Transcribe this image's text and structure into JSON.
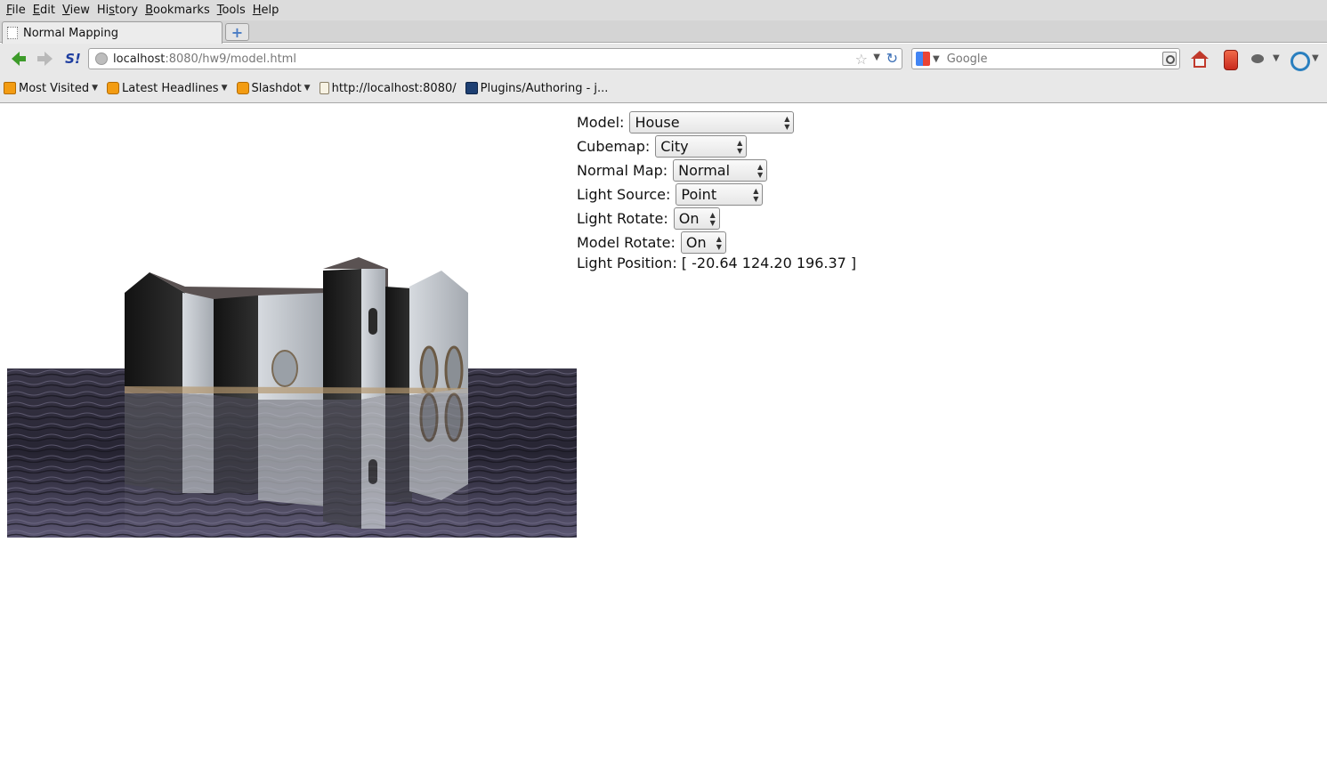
{
  "menubar": {
    "items": [
      {
        "label": "File",
        "accel": "F",
        "rest": "ile"
      },
      {
        "label": "Edit",
        "accel": "E",
        "rest": "dit"
      },
      {
        "label": "View",
        "accel": "V",
        "rest": "iew"
      },
      {
        "label": "History",
        "accel": "",
        "pre": "Hi",
        "mid": "s",
        "post": "tory"
      },
      {
        "label": "Bookmarks",
        "accel": "B",
        "rest": "ookmarks"
      },
      {
        "label": "Tools",
        "accel": "T",
        "rest": "ools"
      },
      {
        "label": "Help",
        "accel": "H",
        "rest": "elp"
      }
    ]
  },
  "tabs": {
    "active_title": "Normal Mapping",
    "new_tab_symbol": "+"
  },
  "navbar": {
    "url_host": "localhost",
    "url_rest": ":8080/hw9/model.html",
    "search_placeholder": "Google",
    "star_symbol": "☆",
    "dropdown_symbol": "▼",
    "reload_symbol": "↻",
    "s_icon_left": "S",
    "s_icon_right": "!"
  },
  "bookmarks": [
    {
      "label": "Most Visited",
      "icon": "rss-folder-icon",
      "has_arrow": true
    },
    {
      "label": "Latest Headlines",
      "icon": "rss-icon",
      "has_arrow": true
    },
    {
      "label": "Slashdot",
      "icon": "rss-icon",
      "has_arrow": true
    },
    {
      "label": "http://localhost:8080/",
      "icon": "page-icon",
      "has_arrow": false
    },
    {
      "label": "Plugins/Authoring - j...",
      "icon": "site-icon",
      "has_arrow": false
    }
  ],
  "controls": {
    "model": {
      "label": "Model:",
      "value": "House"
    },
    "cubemap": {
      "label": "Cubemap:",
      "value": "City"
    },
    "normal_map": {
      "label": "Normal Map:",
      "value": "Normal"
    },
    "light_source": {
      "label": "Light Source:",
      "value": "Point"
    },
    "light_rotate": {
      "label": "Light Rotate:",
      "value": "On"
    },
    "model_rotate": {
      "label": "Model Rotate:",
      "value": "On"
    },
    "light_position": {
      "label": "Light Position:",
      "value": "[ -20.64 124.20 196.37 ]"
    }
  },
  "colors": {
    "water_dark": "#2e2c3a",
    "water_light": "#6f6a83",
    "wall_light": "#b9bec4",
    "wall_dark": "#1f1f1f",
    "roof": "#5a5252"
  }
}
